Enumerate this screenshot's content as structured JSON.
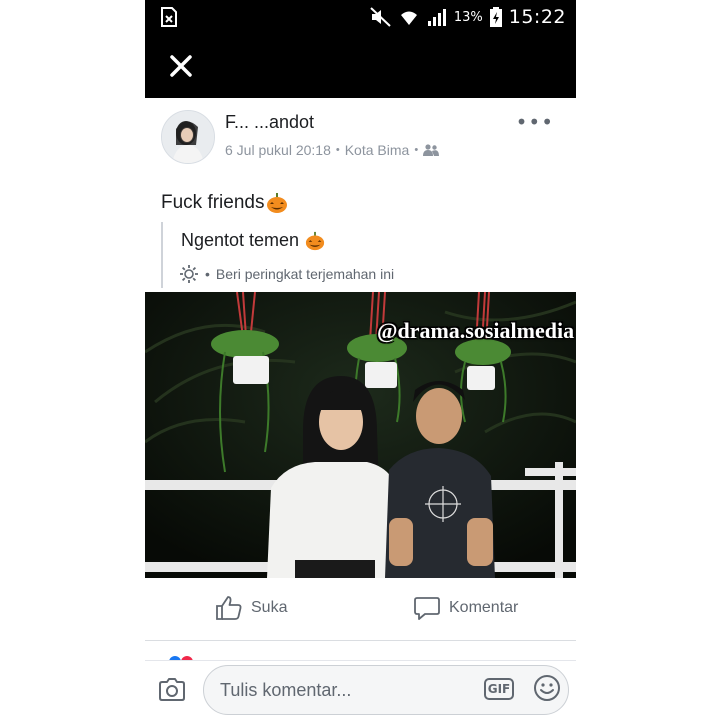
{
  "status_bar": {
    "battery_percent": "13%",
    "time": "15:22",
    "icons": [
      "no-sim-icon",
      "mute-icon",
      "wifi-icon",
      "signal-icon",
      "battery-charging-icon"
    ]
  },
  "top_bar": {
    "close_icon": "close-icon"
  },
  "post": {
    "author": "F...         ...andot",
    "timestamp": "6 Jul pukul 20:18",
    "location": "Kota Bima",
    "audience_icon": "friends-icon",
    "more_label": "•••",
    "text": "Fuck friends",
    "text_emoji": "jack-o-lantern",
    "translation": "Ngentot temen",
    "rate_translation": "Beri peringkat terjemahan ini",
    "photo_watermark": "@drama.sosialmedia"
  },
  "actions": {
    "like_label": "Suka",
    "comment_label": "Komentar"
  },
  "comment_bar": {
    "placeholder": "Tulis komentar...",
    "gif_label": "GIF"
  },
  "colors": {
    "status_bar_bg": "#000000",
    "meta_text": "#8d949e",
    "action_text": "#606770"
  }
}
